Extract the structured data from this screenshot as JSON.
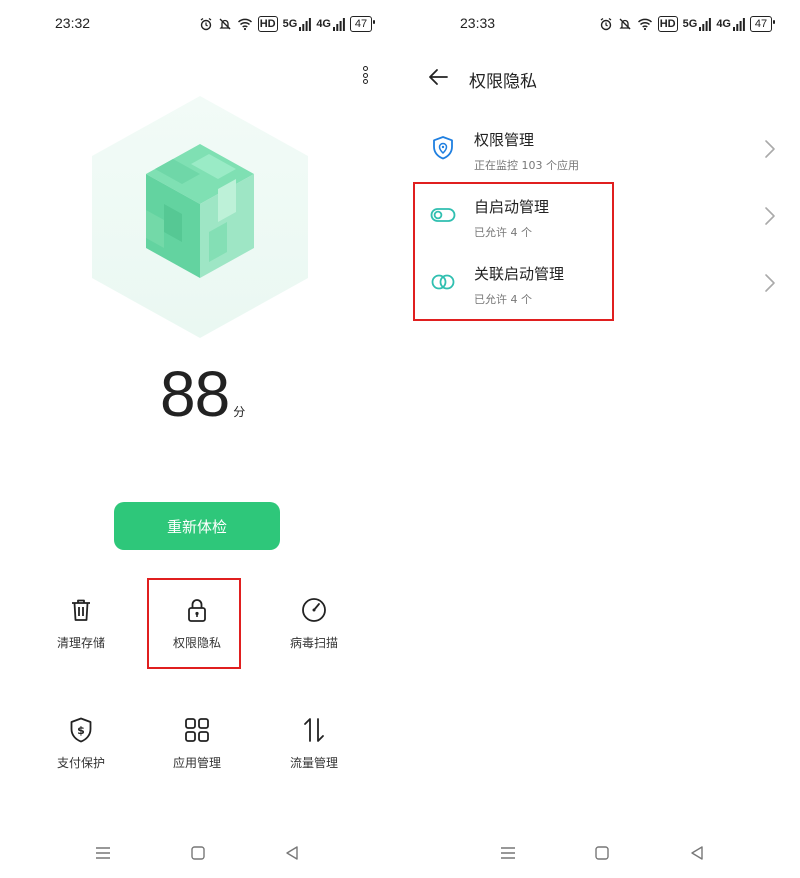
{
  "left_screen": {
    "status_bar": {
      "time": "23:32",
      "hd_label": "HD",
      "signal_label_1": "5G",
      "signal_label_2": "4G",
      "battery": "47"
    },
    "score": {
      "value": "88",
      "unit": "分"
    },
    "recheck_button": "重新体检",
    "grid": {
      "clean_storage": "清理存储",
      "privacy_permissions": "权限隐私",
      "virus_scan": "病毒扫描",
      "payment_protection": "支付保护",
      "app_management": "应用管理",
      "data_management": "流量管理"
    }
  },
  "right_screen": {
    "status_bar": {
      "time": "23:33",
      "hd_label": "HD",
      "signal_label_1": "5G",
      "signal_label_2": "4G",
      "battery": "47"
    },
    "title": "权限隐私",
    "items": [
      {
        "title": "权限管理",
        "subtitle": "正在监控 103 个应用",
        "icon": "shield-location-icon"
      },
      {
        "title": "自启动管理",
        "subtitle": "已允许 4 个",
        "icon": "toggle-icon"
      },
      {
        "title": "关联启动管理",
        "subtitle": "已允许 4 个",
        "icon": "link-rings-icon"
      }
    ]
  },
  "colors": {
    "accent_green": "#2ec77a",
    "icon_blue": "#1f7fe0",
    "icon_teal": "#2fbfb0",
    "highlight_red": "#e01f1f"
  }
}
